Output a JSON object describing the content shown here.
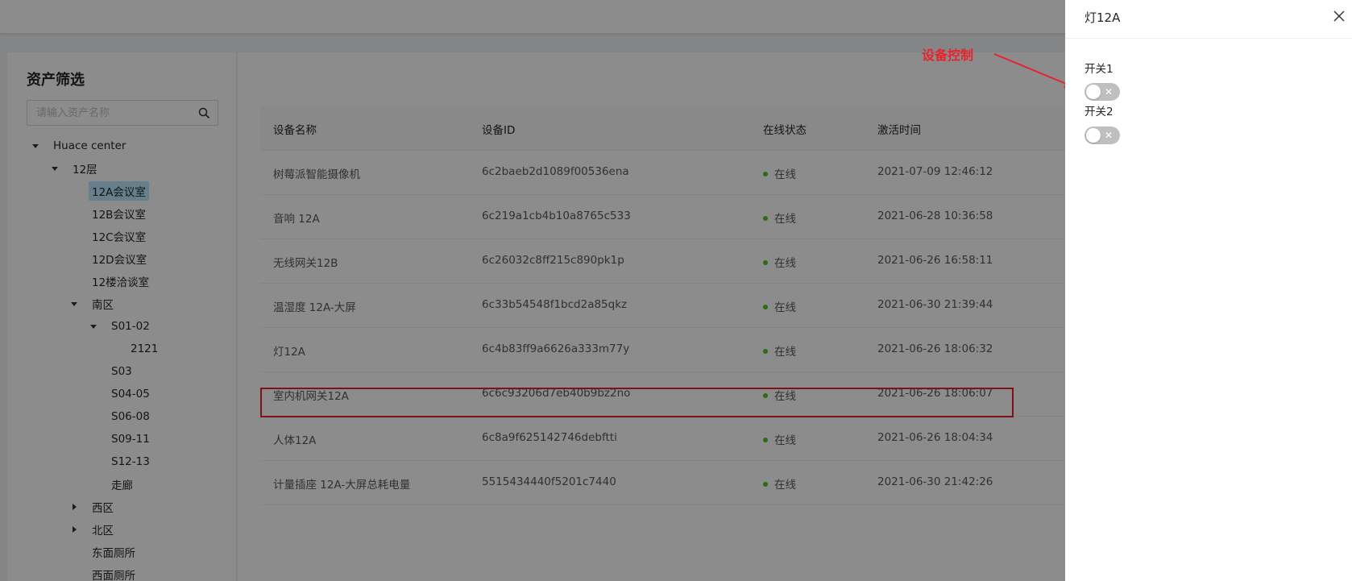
{
  "sidebar": {
    "title": "资产筛选",
    "search_placeholder": "请输入资产名称",
    "tree": [
      {
        "label": "Huace center",
        "caret": "down"
      },
      {
        "label": "12层",
        "caret": "down"
      },
      {
        "label": "12A会议室",
        "caret": "none",
        "selected": true
      },
      {
        "label": "12B会议室",
        "caret": "none"
      },
      {
        "label": "12C会议室",
        "caret": "none"
      },
      {
        "label": "12D会议室",
        "caret": "none"
      },
      {
        "label": "12楼洽谈室",
        "caret": "none"
      },
      {
        "label": "南区",
        "caret": "down"
      },
      {
        "label": "S01-02",
        "caret": "down"
      },
      {
        "label": "2121",
        "caret": "none"
      },
      {
        "label": "S03",
        "caret": "none"
      },
      {
        "label": "S04-05",
        "caret": "none"
      },
      {
        "label": "S06-08",
        "caret": "none"
      },
      {
        "label": "S09-11",
        "caret": "none"
      },
      {
        "label": "S12-13",
        "caret": "none"
      },
      {
        "label": "走廊",
        "caret": "none"
      },
      {
        "label": "西区",
        "caret": "right"
      },
      {
        "label": "北区",
        "caret": "right"
      },
      {
        "label": "东面厕所",
        "caret": "none"
      },
      {
        "label": "西面厕所",
        "caret": "none"
      }
    ]
  },
  "table": {
    "columns": [
      "设备名称",
      "设备ID",
      "在线状态",
      "激活时间"
    ],
    "rows": [
      {
        "name": "树莓派智能摄像机",
        "id": "6c2baeb2d1089f00536ena",
        "status": "在线",
        "time": "2021-07-09 12:46:12"
      },
      {
        "name": "音响 12A",
        "id": "6c219a1cb4b10a8765c533",
        "status": "在线",
        "time": "2021-06-28 10:36:58"
      },
      {
        "name": "无线网关12B",
        "id": "6c26032c8ff215c890pk1p",
        "status": "在线",
        "time": "2021-06-26 16:58:11"
      },
      {
        "name": "温湿度 12A-大屏",
        "id": "6c33b54548f1bcd2a85qkz",
        "status": "在线",
        "time": "2021-06-30 21:39:44"
      },
      {
        "name": "灯12A",
        "id": "6c4b83ff9a6626a333m77y",
        "status": "在线",
        "time": "2021-06-26 18:06:32"
      },
      {
        "name": "室内机网关12A",
        "id": "6c6c93206d7eb40b9bz2no",
        "status": "在线",
        "time": "2021-06-26 18:06:07"
      },
      {
        "name": "人体12A",
        "id": "6c8a9f625142746debftti",
        "status": "在线",
        "time": "2021-06-26 18:04:34"
      },
      {
        "name": "计量插座 12A-大屏总耗电量",
        "id": "5515434440f5201c7440",
        "status": "在线",
        "time": "2021-06-30 21:42:26"
      }
    ]
  },
  "drawer": {
    "title": "灯12A",
    "switches": [
      {
        "label": "开关1",
        "state": "off",
        "off_glyph": "✕"
      },
      {
        "label": "开关2",
        "state": "off",
        "off_glyph": "✕"
      }
    ]
  },
  "annotation": {
    "text": "设备控制",
    "color": "#e8222b"
  },
  "colors": {
    "status_online": "#52c41a",
    "selected_bg": "#bae7ff",
    "highlight_border": "#e8222b"
  }
}
